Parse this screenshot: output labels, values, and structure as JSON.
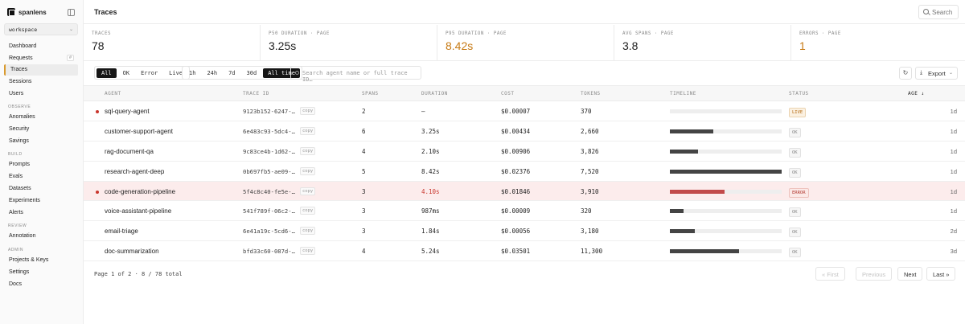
{
  "app": {
    "brand": "spanlens"
  },
  "sidebar": {
    "workspace": "workspace",
    "items": [
      {
        "label": "Dashboard"
      },
      {
        "label": "Requests",
        "kbd": "#"
      },
      {
        "label": "Traces"
      },
      {
        "label": "Sessions"
      },
      {
        "label": "Users"
      }
    ],
    "sections": {
      "observe": "OBSERVE",
      "build": "BUILD",
      "review": "REVIEW",
      "admin": "ADMIN"
    },
    "observe_items": [
      {
        "label": "Anomalies"
      },
      {
        "label": "Security"
      },
      {
        "label": "Savings"
      }
    ],
    "build_items": [
      {
        "label": "Prompts"
      },
      {
        "label": "Evals"
      },
      {
        "label": "Datasets"
      },
      {
        "label": "Experiments"
      },
      {
        "label": "Alerts"
      }
    ],
    "review_items": [
      {
        "label": "Annotation"
      }
    ],
    "admin_items": [
      {
        "label": "Projects & Keys"
      },
      {
        "label": "Settings"
      },
      {
        "label": "Docs"
      }
    ]
  },
  "header": {
    "title": "Traces",
    "search_label": "Search"
  },
  "stats": [
    {
      "label": "TRACES",
      "value": "78"
    },
    {
      "label": "P50 DURATION · PAGE",
      "value": "3.25s"
    },
    {
      "label": "P95 DURATION · PAGE",
      "value": "8.42s"
    },
    {
      "label": "AVG SPANS · PAGE",
      "value": "3.8"
    },
    {
      "label": "ERRORS · PAGE",
      "value": "1"
    }
  ],
  "filters": {
    "status": [
      "All",
      "OK",
      "Error",
      "Live"
    ],
    "range": [
      "1h",
      "24h",
      "7d",
      "30d",
      "All time"
    ],
    "search_placeholder": "Search agent name or full trace ID…",
    "refresh": "↻",
    "export": "Export"
  },
  "table": {
    "headers": [
      "AGENT",
      "TRACE ID",
      "SPANS",
      "DURATION",
      "COST",
      "TOKENS",
      "TIMELINE",
      "STATUS",
      "AGE ↓"
    ],
    "copy_label": "copy",
    "rows": [
      {
        "agent": "sql-query-agent",
        "trace_id": "9123b152-6247-…",
        "spans": "2",
        "duration": "—",
        "cost": "$0.00007",
        "tokens": "370",
        "timeline": 0,
        "status": "LIVE",
        "age": "1d"
      },
      {
        "agent": "customer-support-agent",
        "trace_id": "6e483c93-5dc4-…",
        "spans": "6",
        "duration": "3.25s",
        "cost": "$0.00434",
        "tokens": "2,660",
        "timeline": 0.39,
        "status": "OK",
        "age": "1d"
      },
      {
        "agent": "rag-document-qa",
        "trace_id": "9c83ce4b-1d62-…",
        "spans": "4",
        "duration": "2.10s",
        "cost": "$0.00906",
        "tokens": "3,826",
        "timeline": 0.25,
        "status": "OK",
        "age": "1d"
      },
      {
        "agent": "research-agent-deep",
        "trace_id": "0b697fb5-ae09-…",
        "spans": "5",
        "duration": "8.42s",
        "cost": "$0.02376",
        "tokens": "7,520",
        "timeline": 1.0,
        "status": "OK",
        "age": "1d"
      },
      {
        "agent": "code-generation-pipeline",
        "trace_id": "5f4c8c40-fe5e-…",
        "spans": "3",
        "duration": "4.10s",
        "cost": "$0.01846",
        "tokens": "3,910",
        "timeline": 0.49,
        "status": "ERROR",
        "age": "1d"
      },
      {
        "agent": "voice-assistant-pipeline",
        "trace_id": "541f789f-06c2-…",
        "spans": "3",
        "duration": "987ms",
        "cost": "$0.00009",
        "tokens": "320",
        "timeline": 0.12,
        "status": "OK",
        "age": "1d"
      },
      {
        "agent": "email-triage",
        "trace_id": "6e41a19c-5cd6-…",
        "spans": "3",
        "duration": "1.84s",
        "cost": "$0.00056",
        "tokens": "3,180",
        "timeline": 0.22,
        "status": "OK",
        "age": "2d"
      },
      {
        "agent": "doc-summarization",
        "trace_id": "bfd33c60-087d-…",
        "spans": "4",
        "duration": "5.24s",
        "cost": "$0.03501",
        "tokens": "11,300",
        "timeline": 0.62,
        "status": "OK",
        "age": "3d"
      }
    ]
  },
  "pager": {
    "info": "Page 1 of 2 · 8 / 78 total",
    "first": "« First",
    "previous": "Previous",
    "next": "Next",
    "last": "Last »"
  }
}
